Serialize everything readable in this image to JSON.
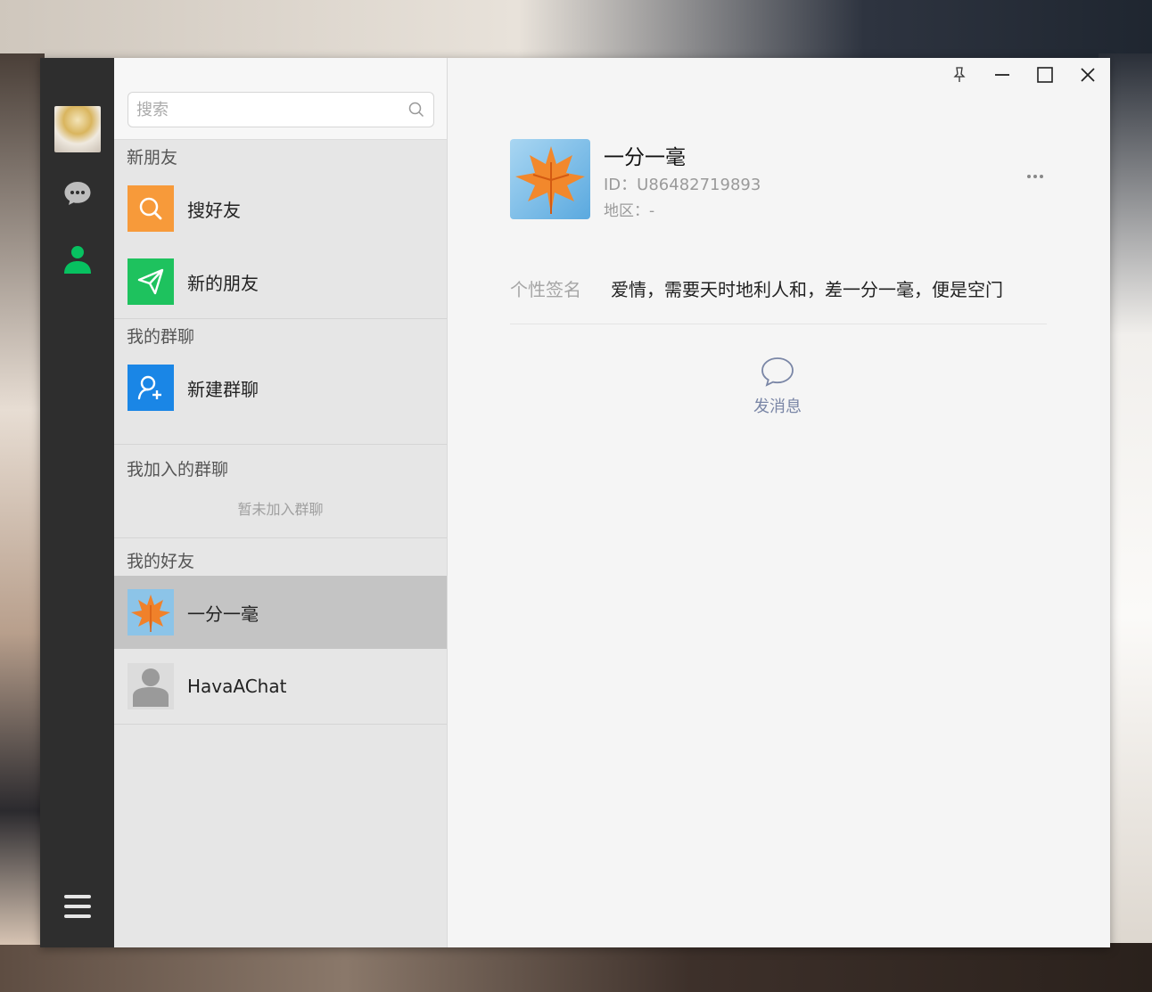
{
  "search": {
    "placeholder": "搜索"
  },
  "sections": {
    "new_friends": {
      "title": "新朋友",
      "items": [
        {
          "label": "搜好友",
          "color": "#f79a3a",
          "icon": "search-icon"
        },
        {
          "label": "新的朋友",
          "color": "#1ec25e",
          "icon": "send-icon"
        }
      ]
    },
    "my_groups": {
      "title": "我的群聊",
      "items": [
        {
          "label": "新建群聊",
          "color": "#1a86e6",
          "icon": "add-group-icon"
        }
      ]
    },
    "joined_groups": {
      "title": "我加入的群聊",
      "empty": "暂未加入群聊"
    },
    "my_friends": {
      "title": "我的好友",
      "items": [
        {
          "label": "一分一毫",
          "icon": "maple-leaf-avatar",
          "selected": true
        },
        {
          "label": "HavaAChat",
          "icon": "default-avatar",
          "selected": false
        }
      ]
    }
  },
  "profile": {
    "name": "一分一毫",
    "id": "ID：U86482719893",
    "region": "地区：-",
    "signature_label": "个性签名",
    "signature": "爱情，需要天时地利人和，差一分一毫，便是空门",
    "send_message": "发消息"
  },
  "colors": {
    "rail": "#2e2e2e",
    "active_nav": "#07c160",
    "send_message": "#7a86a6"
  }
}
